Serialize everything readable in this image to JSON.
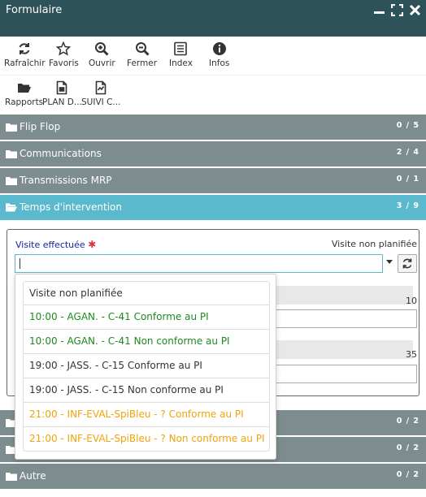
{
  "window": {
    "title": "Formulaire",
    "controls": [
      "minimize-icon",
      "maximize-icon",
      "close-icon"
    ]
  },
  "toolbar": {
    "items": [
      {
        "label": "Rafraîchir",
        "icon": "refresh-icon"
      },
      {
        "label": "Favoris",
        "icon": "star-icon"
      },
      {
        "label": "Ouvrir",
        "icon": "zoom-in-icon"
      },
      {
        "label": "Fermer",
        "icon": "zoom-out-icon"
      },
      {
        "label": "Index",
        "icon": "list-icon"
      },
      {
        "label": "Infos",
        "icon": "info-icon"
      }
    ],
    "items2": [
      {
        "label": "Rapports",
        "icon": "folder-open-icon"
      },
      {
        "label": "PLAN D...",
        "icon": "document-icon"
      },
      {
        "label": "SUIVI C...",
        "icon": "chart-document-icon"
      }
    ]
  },
  "sections": [
    {
      "label": "Flip Flop",
      "count": "0 / 5"
    },
    {
      "label": "Communications",
      "count": "2 / 4"
    },
    {
      "label": "Transmissions MRP",
      "count": "0 / 1"
    },
    {
      "label": "Temps d'intervention",
      "count": "3 / 9"
    },
    {
      "label": "",
      "count": "0 / 2"
    },
    {
      "label": "",
      "count": "0 / 2"
    },
    {
      "label": "Autre",
      "count": "0 / 2"
    }
  ],
  "field": {
    "label": "Visite effectuée",
    "required_mark": "✱",
    "current_value": "Visite non planifiée",
    "input_value": ""
  },
  "numbers": [
    "10",
    "35"
  ],
  "dropdown": {
    "options": [
      {
        "text": "Visite non planifiée",
        "color": "#333333"
      },
      {
        "text": "10:00 - AGAN. - C-41 Conforme au PI",
        "color": "#1e8a1e"
      },
      {
        "text": "10:00 - AGAN. - C-41 Non conforme au PI",
        "color": "#1e8a1e"
      },
      {
        "text": "19:00 - JASS. - C-15 Conforme au PI",
        "color": "#333333"
      },
      {
        "text": "19:00 - JASS. - C-15 Non conforme au PI",
        "color": "#333333"
      },
      {
        "text": "21:00 - INF-EVAL-SpiBleu - ? Conforme au PI",
        "color": "#f0a30a"
      },
      {
        "text": "21:00 - INF-EVAL-SpiBleu - ? Non conforme au PI",
        "color": "#f0a30a"
      }
    ]
  },
  "colors": {
    "titlebar": "#2e5259",
    "section": "#7d8c8e",
    "section_active": "#5bb9ce",
    "label_blue": "#1a1aa6",
    "required_red": "#d9343b"
  }
}
